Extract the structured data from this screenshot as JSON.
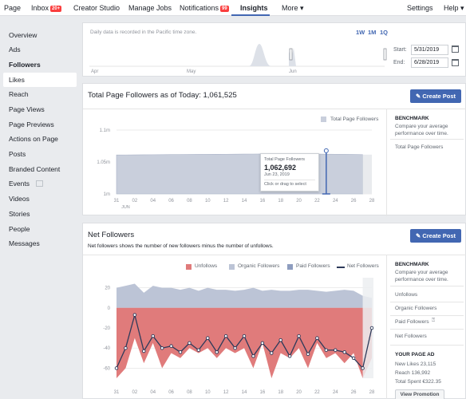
{
  "topnav": {
    "page": "Page",
    "inbox": "Inbox",
    "inbox_badge": "20+",
    "creator_studio": "Creator Studio",
    "manage_jobs": "Manage Jobs",
    "notifications": "Notifications",
    "notifications_badge": "99",
    "insights": "Insights",
    "more": "More ▾",
    "settings": "Settings",
    "help": "Help ▾"
  },
  "sidebar": {
    "items": [
      "Overview",
      "Ads",
      "Followers",
      "Likes",
      "Reach",
      "Page Views",
      "Page Previews",
      "Actions on Page",
      "Posts",
      "Branded Content",
      "Events",
      "Videos",
      "Stories",
      "People",
      "Messages"
    ]
  },
  "daterange": {
    "note": "Daily data is recorded in the Pacific time zone.",
    "presets": [
      "1W",
      "1M",
      "1Q"
    ],
    "months": [
      "Apr",
      "May",
      "Jun"
    ],
    "start_label": "Start:",
    "start_value": "5/31/2019",
    "end_label": "End:",
    "end_value": "6/28/2019"
  },
  "total_followers": {
    "title": "Total Page Followers as of Today: 1,061,525",
    "create_post": "Create Post",
    "legend": "Total Page Followers",
    "tooltip": {
      "label": "Total Page Followers",
      "value": "1,062,692",
      "date": "Jun 23, 2019",
      "hint": "Click or drag to select"
    },
    "benchmark_title": "BENCHMARK",
    "benchmark_desc": "Compare your average performance over time.",
    "benchmark_item": "Total Page Followers"
  },
  "net_followers": {
    "title": "Net Followers",
    "subtitle": "Net followers shows the number of new followers minus the number of unfollows.",
    "create_post": "Create Post",
    "legend": [
      "Unfollows",
      "Organic Followers",
      "Paid Followers",
      "Net Followers"
    ],
    "benchmark_title": "BENCHMARK",
    "benchmark_desc": "Compare your average performance over time.",
    "benchmark_items": [
      "Unfollows",
      "Organic Followers",
      "Paid Followers",
      "Net Followers"
    ],
    "your_page_ad": "YOUR PAGE AD",
    "ad_new_likes": "New Likes 23,115",
    "ad_reach": "Reach 136,992",
    "ad_total_spent": "Total Spent €322.35",
    "view_promotion": "View Promotion"
  },
  "colors": {
    "accent": "#4267b2",
    "unfollows": "#e07b7b",
    "organic": "#bcc4d6",
    "paid": "#8e9dbf",
    "net": "#2d3a5a"
  },
  "chart_data": [
    {
      "type": "area",
      "title": "Total Page Followers as of Today: 1,061,525",
      "series": [
        {
          "name": "Total Page Followers",
          "values": [
            1061000,
            1061100,
            1061200,
            1061300,
            1061400,
            1061500,
            1061600,
            1061700,
            1061800,
            1061900,
            1062000,
            1062100,
            1062200,
            1062300,
            1062400,
            1062500,
            1062550,
            1062600,
            1062650,
            1062692,
            1062600,
            1062500,
            1062400,
            1062300,
            1062200,
            1062000,
            1061800,
            1061525
          ]
        }
      ],
      "x": [
        "31",
        "01",
        "02",
        "03",
        "04",
        "05",
        "06",
        "07",
        "08",
        "09",
        "10",
        "11",
        "12",
        "13",
        "14",
        "15",
        "16",
        "17",
        "18",
        "19",
        "20",
        "21",
        "22",
        "23",
        "24",
        "25",
        "26",
        "27",
        "28"
      ],
      "x_tick_labels": [
        "31",
        "02",
        "04",
        "06",
        "08",
        "10",
        "12",
        "14",
        "16",
        "18",
        "20",
        "22",
        "24",
        "26",
        "28"
      ],
      "x_sublabel": "JUN",
      "y_tick_labels": [
        "1m",
        "1.05m",
        "1.1m"
      ],
      "ylim": [
        1000000,
        1100000
      ]
    },
    {
      "type": "area",
      "title": "Net Followers",
      "categories": [
        "31",
        "01",
        "02",
        "03",
        "04",
        "05",
        "06",
        "07",
        "08",
        "09",
        "10",
        "11",
        "12",
        "13",
        "14",
        "15",
        "16",
        "17",
        "18",
        "19",
        "20",
        "21",
        "22",
        "23",
        "24",
        "25",
        "26",
        "27",
        "28"
      ],
      "x_tick_labels": [
        "31",
        "02",
        "04",
        "06",
        "08",
        "10",
        "12",
        "14",
        "16",
        "18",
        "20",
        "22",
        "24",
        "26",
        "28"
      ],
      "y_tick_labels": [
        "20",
        "0",
        "-20",
        "-40",
        "-60"
      ],
      "ylim": [
        -70,
        30
      ],
      "series": [
        {
          "name": "Organic Followers",
          "values": [
            20,
            22,
            24,
            15,
            22,
            20,
            20,
            18,
            20,
            17,
            20,
            18,
            18,
            17,
            18,
            20,
            17,
            18,
            17,
            17,
            18,
            18,
            17,
            16,
            17,
            18,
            17,
            12,
            10
          ]
        },
        {
          "name": "Paid Followers",
          "values": [
            0,
            0,
            0,
            0,
            0,
            0,
            0,
            0,
            0,
            0,
            0,
            0,
            0,
            0,
            0,
            0,
            0,
            0,
            0,
            0,
            0,
            0,
            0,
            0,
            0,
            0,
            0,
            0,
            0
          ]
        },
        {
          "name": "Unfollows",
          "values": [
            -80,
            -60,
            -30,
            -55,
            -35,
            -60,
            -45,
            -50,
            -40,
            -45,
            -40,
            -50,
            -40,
            -45,
            -40,
            -60,
            -35,
            -70,
            -45,
            -50,
            -40,
            -60,
            -35,
            -50,
            -45,
            -55,
            -45,
            -70,
            -50
          ]
        },
        {
          "name": "Net Followers",
          "values": [
            -60,
            -40,
            -7,
            -43,
            -28,
            -40,
            -38,
            -44,
            -35,
            -42,
            -30,
            -44,
            -28,
            -40,
            -28,
            -48,
            -35,
            -45,
            -32,
            -48,
            -28,
            -46,
            -30,
            -42,
            -42,
            -44,
            -50,
            -60,
            -20
          ]
        }
      ]
    }
  ]
}
